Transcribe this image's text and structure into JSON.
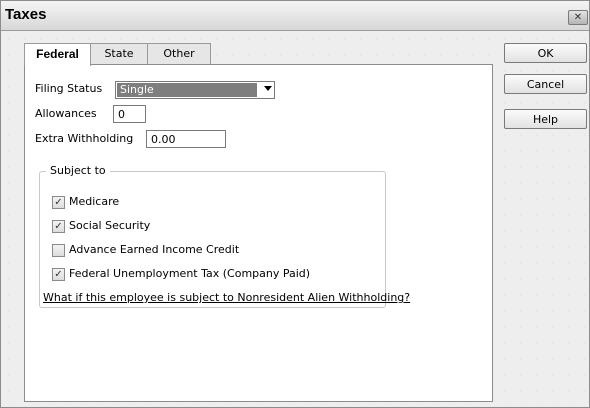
{
  "window": {
    "title": "Taxes",
    "close_symbol": "✕"
  },
  "tabs": [
    {
      "label": "Federal",
      "active": true
    },
    {
      "label": "State",
      "active": false
    },
    {
      "label": "Other",
      "active": false
    }
  ],
  "form": {
    "filing_status_label": "Filing Status",
    "filing_status_value": "Single",
    "allowances_label": "Allowances",
    "allowances_value": "0",
    "extra_withholding_label": "Extra Withholding",
    "extra_withholding_value": "0.00"
  },
  "subject_to": {
    "title": "Subject to",
    "items": [
      {
        "label": "Medicare",
        "checked": true
      },
      {
        "label": "Social Security",
        "checked": true
      },
      {
        "label": "Advance Earned Income Credit",
        "checked": false
      },
      {
        "label": "Federal Unemployment Tax (Company Paid)",
        "checked": true
      }
    ]
  },
  "link_text": "What if this employee is subject to Nonresident Alien Withholding?",
  "buttons": {
    "ok": "OK",
    "cancel": "Cancel",
    "help": "Help"
  },
  "check_mark": "✓"
}
